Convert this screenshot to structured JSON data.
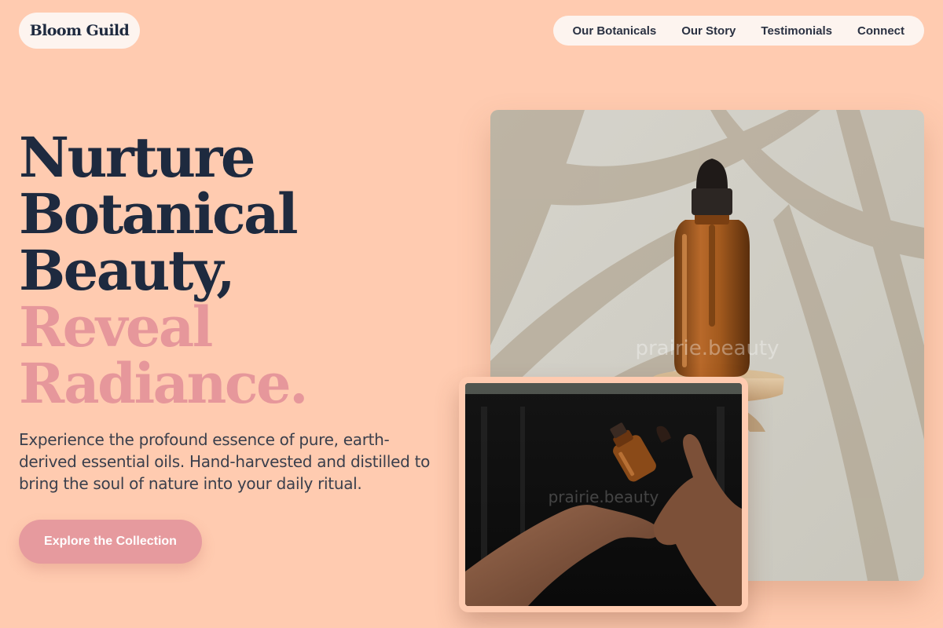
{
  "brand": {
    "name": "Bloom Guild"
  },
  "nav": {
    "items": [
      {
        "label": "Our Botanicals"
      },
      {
        "label": "Our Story"
      },
      {
        "label": "Testimonials"
      },
      {
        "label": "Connect"
      }
    ]
  },
  "hero": {
    "headline": [
      "Nurture",
      "Botanical",
      "Beauty,"
    ],
    "accent": [
      "Reveal",
      "Radiance."
    ],
    "description": "Experience the profound essence of pure, earth-derived essential oils. Hand-harvested and distilled to bring the soul of nature into your daily ritual.",
    "cta_label": "Explore the Collection"
  },
  "images": {
    "main_watermark": "prairie.beauty",
    "secondary_watermark": "prairie.beauty"
  },
  "colors": {
    "background": "#ffcbb0",
    "primary_text": "#1e2a3f",
    "accent": "#e69a9e"
  }
}
